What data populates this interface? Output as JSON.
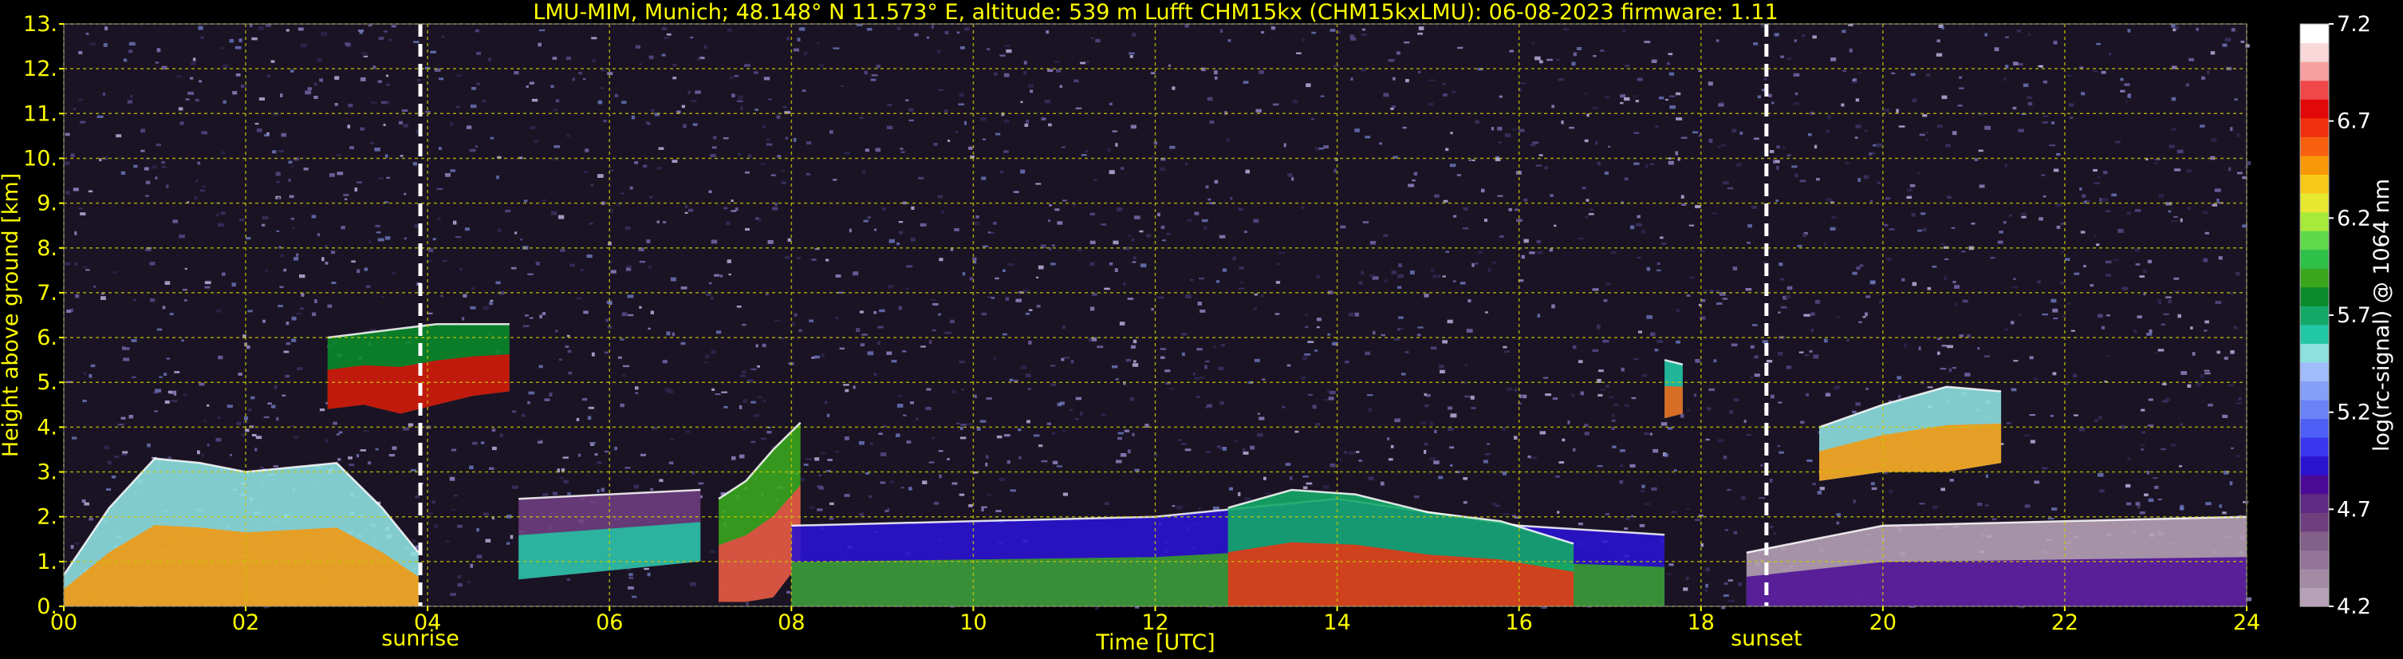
{
  "chart_data": {
    "type": "heatmap",
    "title": "LMU-MIM, Munich; 48.148° N 11.573° E, altitude: 539 m    Lufft CHM15kx (CHM15kxLMU): 06-08-2023    firmware: 1.11",
    "xlabel": "Time [UTC]",
    "ylabel": "Height above ground [km]",
    "xlim": [
      0,
      24
    ],
    "ylim": [
      0,
      13
    ],
    "x_ticks": [
      0,
      2,
      4,
      6,
      8,
      10,
      12,
      14,
      16,
      18,
      20,
      22,
      24
    ],
    "x_tick_labels": [
      "00",
      "02",
      "04",
      "06",
      "08",
      "10",
      "12",
      "14",
      "16",
      "18",
      "20",
      "22",
      "24"
    ],
    "y_ticks": [
      0,
      1,
      2,
      3,
      4,
      5,
      6,
      7,
      8,
      9,
      10,
      11,
      12,
      13
    ],
    "y_tick_labels": [
      "0.",
      "1.",
      "2.",
      "3.",
      "4.",
      "5.",
      "6.",
      "7.",
      "8.",
      "9.",
      "10.",
      "11.",
      "12.",
      "13."
    ],
    "grid": true,
    "grid_color": "#c8c800",
    "text_color": "#ffff00",
    "background": "#000000",
    "annotations": [
      {
        "label": "sunrise",
        "x": 3.92
      },
      {
        "label": "sunset",
        "x": 18.72
      }
    ],
    "colorbar": {
      "label": "log(rc-signal) @ 1064 nm",
      "min": 4.2,
      "max": 7.2,
      "tick_values": [
        4.2,
        4.7,
        5.2,
        5.7,
        6.2,
        6.7,
        7.2
      ],
      "tick_labels": [
        "4.2",
        "4.7",
        "5.2",
        "5.7",
        "6.2",
        "6.7",
        "7.2"
      ],
      "colors": [
        "#b6a1b6",
        "#a58aa5",
        "#94739a",
        "#83608a",
        "#6e3e7e",
        "#5e2a82",
        "#4a0a96",
        "#2a14d0",
        "#3a36f0",
        "#4f5ef4",
        "#6a82f6",
        "#86a0f8",
        "#a0bcfa",
        "#8ee0e0",
        "#22c8a6",
        "#14a868",
        "#0a8a2a",
        "#3aa61e",
        "#2fc04a",
        "#5fd84a",
        "#a8ea3a",
        "#e8e830",
        "#f8c818",
        "#f89808",
        "#f86010",
        "#f03010",
        "#e00808",
        "#f04848",
        "#f8a0a0",
        "#f8d8d8",
        "#ffffff"
      ]
    },
    "features": [
      {
        "name": "boundary-layer-morning",
        "x": [
          0.0,
          0.5,
          1.0,
          1.5,
          2.0,
          2.5,
          3.0,
          3.5,
          3.9
        ],
        "top_km": [
          0.7,
          2.2,
          3.3,
          3.2,
          3.0,
          3.1,
          3.2,
          2.2,
          1.2
        ],
        "level": 6.5
      },
      {
        "name": "cloud-layer-early",
        "x": [
          2.9,
          3.3,
          3.7,
          4.1,
          4.5,
          4.9
        ],
        "base_km": [
          4.4,
          4.5,
          4.3,
          4.5,
          4.7,
          4.8
        ],
        "top_km": [
          6.0,
          6.1,
          6.2,
          6.3,
          6.3,
          6.3
        ],
        "level": 6.8
      },
      {
        "name": "residual-layer",
        "x": [
          5.0,
          6.0,
          7.0
        ],
        "base_km": [
          0.6,
          0.8,
          1.0
        ],
        "top_km": [
          2.4,
          2.5,
          2.6
        ],
        "level": 5.6
      },
      {
        "name": "thermal-plume-0730",
        "x": [
          7.2,
          7.5,
          7.8,
          8.1
        ],
        "base_km": [
          0.1,
          0.1,
          0.2,
          1.0
        ],
        "top_km": [
          2.4,
          2.8,
          3.5,
          4.1
        ],
        "level": 6.9
      },
      {
        "name": "daytime-boundary-layer",
        "x": [
          8.0,
          10.0,
          12.0,
          14.0,
          16.0,
          17.6
        ],
        "base_km": [
          0.0,
          0.0,
          0.0,
          0.0,
          0.0,
          0.0
        ],
        "top_km": [
          1.8,
          1.9,
          2.0,
          2.4,
          1.8,
          1.6
        ],
        "level": 5.9
      },
      {
        "name": "convective-cores-afternoon",
        "x": [
          12.8,
          13.5,
          14.2,
          15.0,
          15.8,
          16.6
        ],
        "base_km": [
          0.0,
          0.0,
          0.0,
          0.0,
          0.0,
          0.0
        ],
        "top_km": [
          2.2,
          2.6,
          2.5,
          2.1,
          1.9,
          1.4
        ],
        "level": 6.7
      },
      {
        "name": "cloud-1745",
        "x": [
          17.6,
          17.8
        ],
        "base_km": [
          4.2,
          4.3
        ],
        "top_km": [
          5.5,
          5.4
        ],
        "level": 6.6
      },
      {
        "name": "cloud-layer-evening",
        "x": [
          19.3,
          20.0,
          20.7,
          21.3
        ],
        "base_km": [
          2.8,
          3.0,
          3.0,
          3.2
        ],
        "top_km": [
          4.0,
          4.5,
          4.9,
          4.8
        ],
        "level": 6.5
      },
      {
        "name": "evening-boundary-layer",
        "x": [
          18.5,
          20.0,
          22.0,
          24.0
        ],
        "base_km": [
          0.0,
          0.0,
          0.0,
          0.0
        ],
        "top_km": [
          1.2,
          1.8,
          1.9,
          2.0
        ],
        "level": 4.8
      }
    ]
  }
}
